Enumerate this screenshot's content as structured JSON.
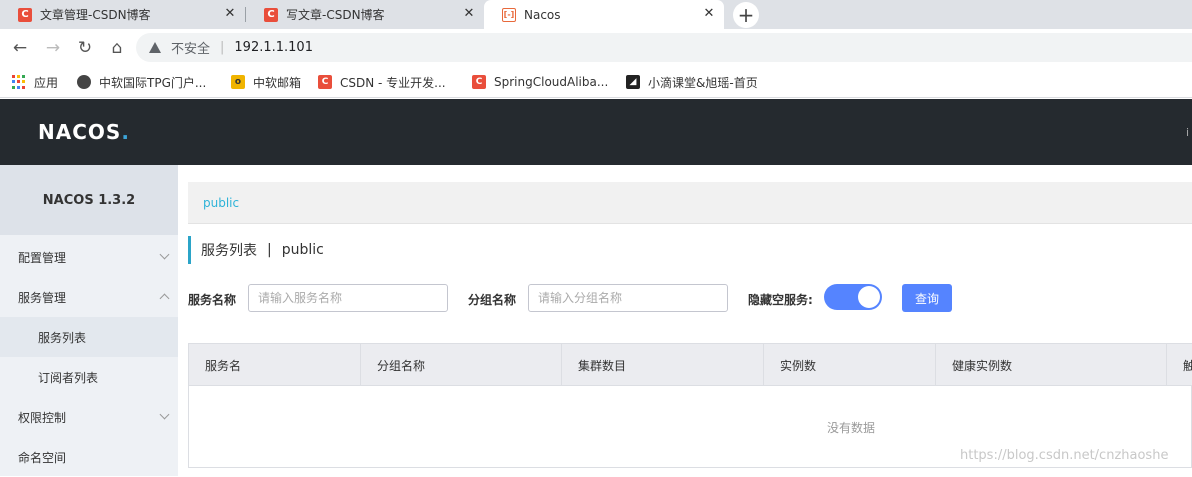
{
  "browser": {
    "tabs": [
      {
        "label": "文章管理-CSDN博客",
        "icon": "csdn-icon",
        "active": false
      },
      {
        "label": "写文章-CSDN博客",
        "icon": "csdn-icon",
        "active": false
      },
      {
        "label": "Nacos",
        "icon": "nacos-icon",
        "active": true
      }
    ],
    "new_tab": "+",
    "address": {
      "security_label": "不安全",
      "url": "192.1.1.101"
    },
    "bookmarks": [
      {
        "label": "应用",
        "icon": "apps-icon"
      },
      {
        "label": "中软国际TPG门户...",
        "icon": "globe-icon"
      },
      {
        "label": "中软邮箱",
        "icon": "mail-icon"
      },
      {
        "label": "CSDN - 专业开发...",
        "icon": "csdn-icon"
      },
      {
        "label": "SpringCloudAliba...",
        "icon": "csdn-icon"
      },
      {
        "label": "小滴课堂&旭瑶-首页",
        "icon": "xdclass-icon"
      }
    ]
  },
  "header": {
    "logo": "NACOS",
    "logo_dot": "."
  },
  "sidebar": {
    "version": "NACOS 1.3.2",
    "items": [
      {
        "label": "配置管理",
        "expanded": false
      },
      {
        "label": "服务管理",
        "expanded": true
      },
      {
        "label": "服务列表",
        "sub": true,
        "selected": true
      },
      {
        "label": "订阅者列表",
        "sub": true
      },
      {
        "label": "权限控制",
        "expanded": false
      },
      {
        "label": "命名空间"
      }
    ]
  },
  "main": {
    "breadcrumb": "public",
    "title": "服务列表",
    "title_sep": "|",
    "title_namespace": "public",
    "filters": {
      "service_name_label": "服务名称",
      "service_name_placeholder": "请输入服务名称",
      "group_name_label": "分组名称",
      "group_name_placeholder": "请输入分组名称",
      "hide_empty_label": "隐藏空服务:",
      "hide_empty_on": true,
      "query_label": "查询"
    },
    "table": {
      "columns": [
        "服务名",
        "分组名称",
        "集群数目",
        "实例数",
        "健康实例数",
        "触"
      ],
      "empty_text": "没有数据"
    }
  },
  "watermark": "https://blog.csdn.net/cnzhaoshe",
  "colors": {
    "accent": "#5584ff",
    "header_bg": "#252a2f",
    "link": "#2eb3d8"
  }
}
